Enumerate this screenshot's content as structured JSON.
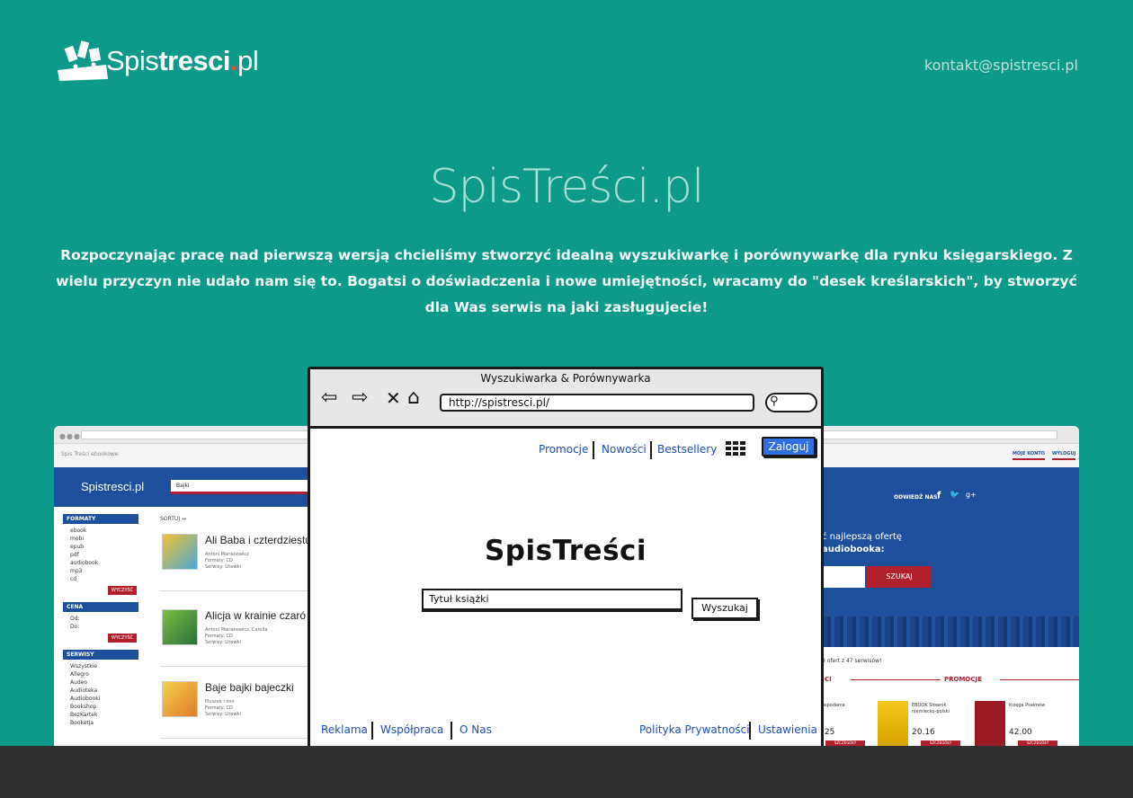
{
  "header": {
    "logo_text_regular": "Spis",
    "logo_text_bold": "tresci",
    "logo_text_dot": ".",
    "logo_text_tld": "pl",
    "contact_email": "kontakt@spistresci.pl"
  },
  "hero": {
    "title": "SpisTreści.pl",
    "description": "Rozpoczynając pracę nad pierwszą wersją chcieliśmy stworzyć idealną wyszukiwarkę i porównywarkę dla rynku księgarskiego. Z wielu przyczyn nie udało nam się to. Bogatsi o doświadczenia i nowe umiejętności, wracamy do \"desek kreślarskich\", by stworzyć dla Was serwis na jaki zasługujecie!"
  },
  "left_screenshot": {
    "tabs": "Spis Treści      ebookowe",
    "logo": "Spistresci.pl",
    "search_value": "Bajki",
    "sort_label": "SORTUJ  ↔",
    "sidebar": [
      {
        "heading": "FORMATY",
        "items": [
          "ebook",
          "mobi",
          "epub",
          "pdf",
          "audiobook",
          "mp3",
          "cd"
        ],
        "button": "WYCZYŚĆ"
      },
      {
        "heading": "CENA",
        "items": [
          "Od:",
          "Do:"
        ],
        "button": "WYCZYŚĆ"
      },
      {
        "heading": "SERWISY",
        "items": [
          "Wszystkie",
          "Allegro",
          "Audeo",
          "Audioteka",
          "Audiobooki",
          "Bookshop",
          "BezKartek",
          "Booketja"
        ],
        "button": ""
      }
    ],
    "results": [
      {
        "title": "Ali Baba i czterdziestu",
        "meta1": "Antoni Marianowicz",
        "meta2": "Formaty: CD",
        "meta3": "Serwisy: Litewki"
      },
      {
        "title": "Alicja w krainie czaró",
        "meta1": "Antoni Marianowicz, Carolla",
        "meta2": "Formaty: CD",
        "meta3": "Serwisy: Litewki"
      },
      {
        "title": "Baje bajki bajeczki",
        "meta1": "Pluszek i inni",
        "meta2": "Formaty: CD",
        "meta3": "Serwisy: Litewki"
      }
    ]
  },
  "right_screenshot": {
    "account_link": "MOJE KONTO",
    "logout_link": "WYLOGUJ",
    "follow_label": "ODWIEDŹ NAS:",
    "tagline_1": "ć najlepszą ofertę",
    "tagline_2": "audiobooka:",
    "search_button": "SZUKAJ",
    "offers_count": "9 ofert z 47 serwisów!",
    "promo_left": "OŚCI",
    "promo_heading": "PROMOCJE",
    "books": [
      {
        "title": "e gospodarce",
        "price": ".25",
        "button": "SZCZEGÓŁY"
      },
      {
        "title": "EBOOK Słownik niemiecko-polski",
        "price": "20.16",
        "button": "SZCZEGÓŁY"
      },
      {
        "title": "Księga Psalmów",
        "price": "42.00",
        "button": "SZCZEGÓŁY"
      }
    ]
  },
  "wireframe": {
    "window_title": "Wyszukiwarka & Porównywarka",
    "url": "http://spistresci.pl/",
    "nav": [
      "Promocje",
      "Nowości",
      "Bestsellery"
    ],
    "login_button": "Zaloguj",
    "brand": "SpisTreści",
    "search_placeholder": "Tytuł książki",
    "search_button": "Wyszukaj",
    "footer_left": [
      "Reklama",
      "Współpraca",
      "O Nas"
    ],
    "footer_right": [
      "Polityka Prywatności",
      "Ustawienia"
    ]
  },
  "colors": {
    "background": "#0e9a8a",
    "bottom_bar": "#303030",
    "site_blue": "#1e4f9c",
    "site_red": "#b3202d",
    "wire_link": "#1c4fb8",
    "wire_login": "#2f6fe0"
  },
  "icons": {
    "logo": "books-logo-icon",
    "back": "arrow-left-icon",
    "forward": "arrow-right-icon",
    "close": "close-icon",
    "home": "home-icon",
    "search": "search-icon",
    "apps": "grid-icon"
  }
}
